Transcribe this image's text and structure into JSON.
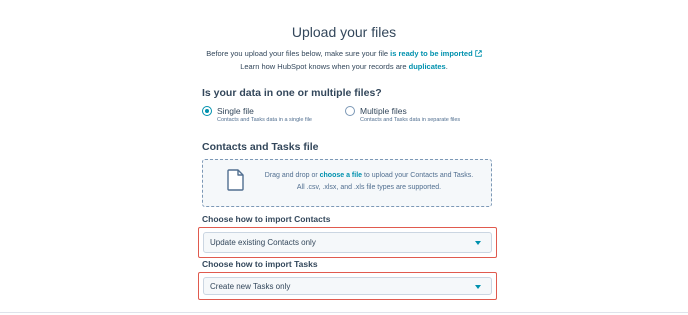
{
  "page": {
    "title": "Upload your files",
    "intro_line1_prefix": "Before you upload your files below, make sure your file ",
    "intro_link1": "is ready to be imported",
    "intro_line2_prefix": "Learn how HubSpot knows when your records are ",
    "intro_link2": "duplicates",
    "intro_line2_suffix": "."
  },
  "question": {
    "heading": "Is your data in one or multiple files?",
    "options": [
      {
        "label": "Single file",
        "sub": "Contacts and Tasks data in a single file",
        "selected": true
      },
      {
        "label": "Multiple files",
        "sub": "Contacts and Tasks data in separate files",
        "selected": false
      }
    ]
  },
  "upload": {
    "heading": "Contacts and Tasks file",
    "prefix": "Drag and drop or ",
    "link": "choose a file",
    "suffix": " to upload your Contacts and Tasks.",
    "line2": "All .csv, .xlsx, and .xls file types are supported."
  },
  "contacts_import": {
    "label": "Choose how to import Contacts",
    "value": "Update existing Contacts only"
  },
  "tasks_import": {
    "label": "Choose how to import Tasks",
    "value": "Create new Tasks only"
  },
  "icons": {
    "external": "external-link-icon",
    "file": "file-icon",
    "caret": "caret-down-icon"
  },
  "colors": {
    "accent": "#0091ae",
    "text": "#33475b",
    "highlight": "#e05a4e"
  }
}
